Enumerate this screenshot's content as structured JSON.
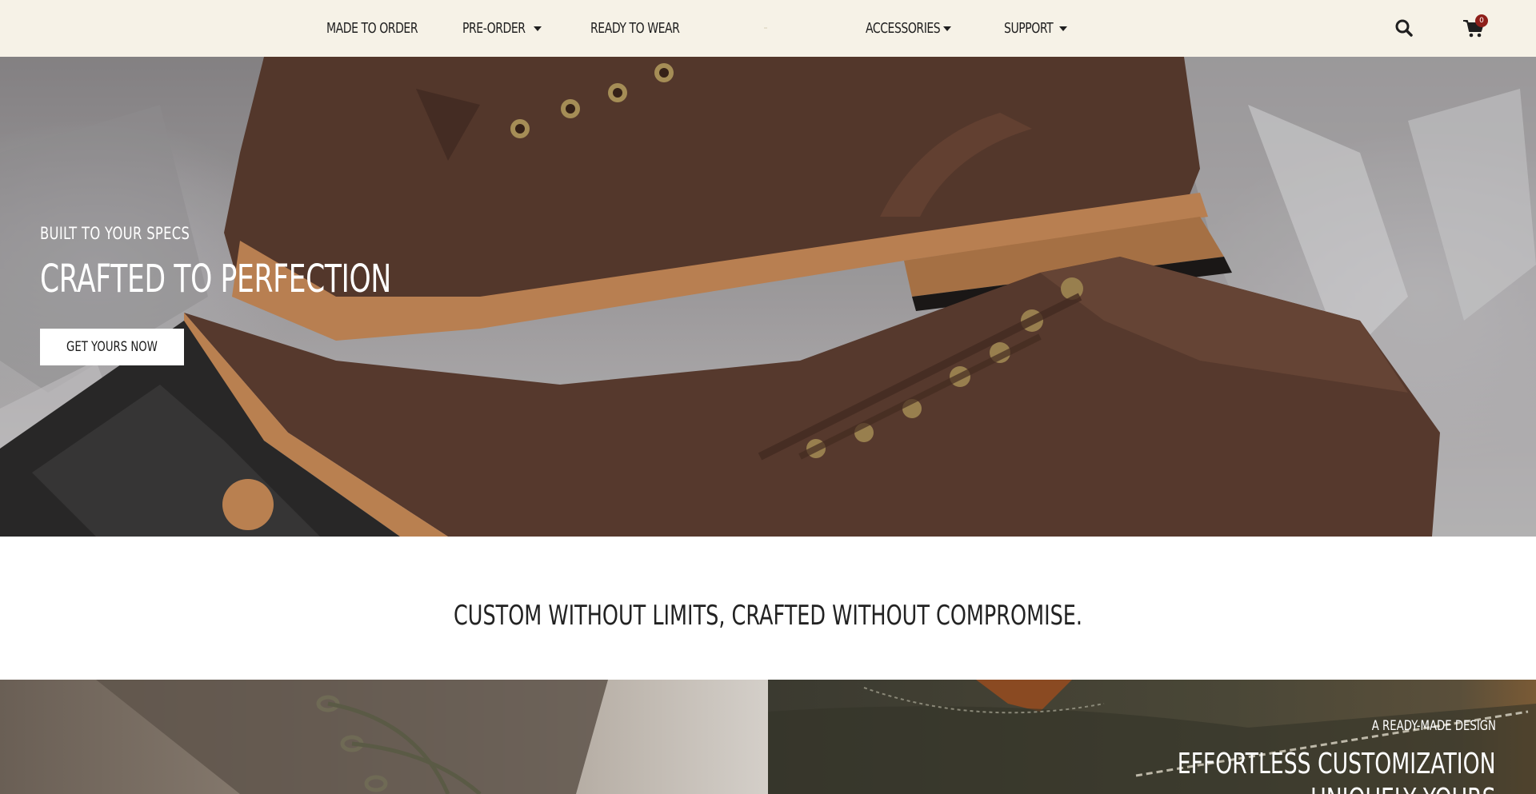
{
  "header": {
    "nav": [
      {
        "label": "MADE TO ORDER",
        "has_dropdown": false
      },
      {
        "label": "PRE-ORDER",
        "has_dropdown": true
      },
      {
        "label": "READY TO WEAR",
        "has_dropdown": false
      },
      {
        "label": "ACCESSORIES",
        "has_dropdown": true
      },
      {
        "label": "SUPPORT",
        "has_dropdown": true
      }
    ],
    "search_icon": "search-icon",
    "cart_icon": "cart-icon",
    "cart_count": "0"
  },
  "hero": {
    "kicker": "BUILT TO YOUR SPECS",
    "title": "CRAFTED TO PERFECTION",
    "cta_label": "GET YOURS NOW"
  },
  "tagline": "CUSTOM WITHOUT LIMITS, CRAFTED WITHOUT COMPROMISE.",
  "panels": {
    "right": {
      "kicker": "A READY-MADE DESIGN",
      "title_line1": "EFFORTLESS CUSTOMIZATION",
      "title_line2": "UNIQUELY YOURS"
    }
  },
  "colors": {
    "header_bg": "#f6f2e7",
    "text_dark": "#1f1f1f",
    "badge": "#8e1f1a",
    "leather": "#5a3b2e"
  }
}
